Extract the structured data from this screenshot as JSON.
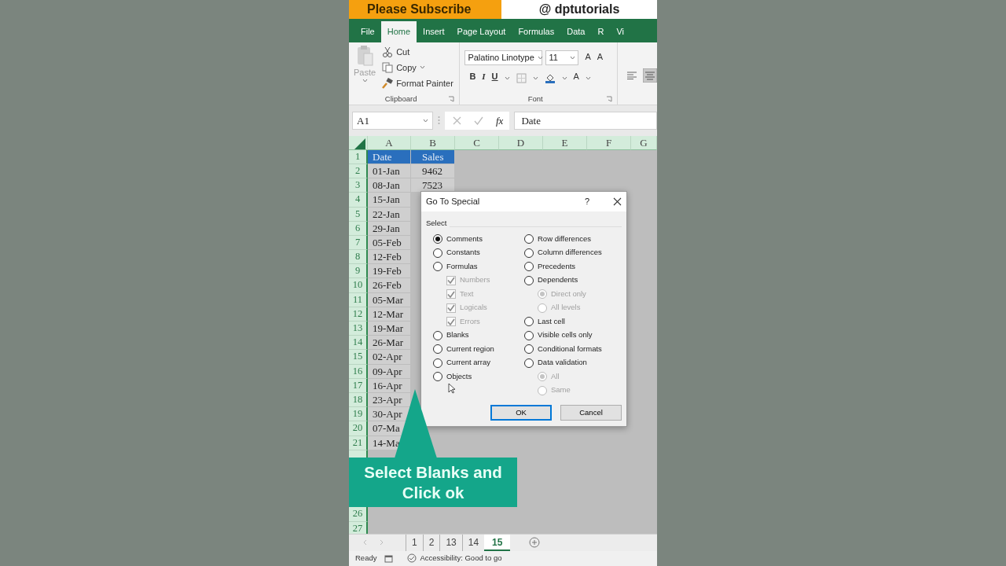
{
  "banner": {
    "left": "Please Subscribe",
    "right": "@ dptutorials"
  },
  "ribbon_tabs": [
    {
      "label": "File",
      "selected": false
    },
    {
      "label": "Home",
      "selected": true
    },
    {
      "label": "Insert",
      "selected": false
    },
    {
      "label": "Page Layout",
      "selected": false
    },
    {
      "label": "Formulas",
      "selected": false
    },
    {
      "label": "Data",
      "selected": false
    },
    {
      "label": "R",
      "selected": false
    },
    {
      "label": "Vi",
      "selected": false
    }
  ],
  "clipboard": {
    "paste": "Paste",
    "label": "Clipboard",
    "items": [
      {
        "kind": "cut",
        "label": "Cut"
      },
      {
        "kind": "copy",
        "label": "Copy"
      },
      {
        "kind": "painter",
        "label": "Format Painter"
      }
    ]
  },
  "font": {
    "name": "Palatino Linotype",
    "size": "11",
    "grow": "A",
    "shrink": "A",
    "bold": "B",
    "italic": "I",
    "underline": "U",
    "font_color_button": "A",
    "label": "Font"
  },
  "formula_bar": {
    "name_box": "A1",
    "fx": "fx",
    "formula": "Date"
  },
  "sheet": {
    "columns": [
      "A",
      "B",
      "C",
      "D",
      "E",
      "F",
      "G"
    ],
    "rows": [
      {
        "header": "1",
        "cells": [
          "Date",
          "Sales"
        ],
        "kind": "header"
      },
      {
        "header": "2",
        "cells": [
          "01-Jan",
          "9462"
        ]
      },
      {
        "header": "3",
        "cells": [
          "08-Jan",
          "7523"
        ]
      },
      {
        "header": "4",
        "cells": [
          "15-Jan"
        ]
      },
      {
        "header": "5",
        "cells": [
          "22-Jan"
        ]
      },
      {
        "header": "6",
        "cells": [
          "29-Jan"
        ]
      },
      {
        "header": "7",
        "cells": [
          "05-Feb"
        ]
      },
      {
        "header": "8",
        "cells": [
          "12-Feb"
        ]
      },
      {
        "header": "9",
        "cells": [
          "19-Feb"
        ]
      },
      {
        "header": "10",
        "cells": [
          "26-Feb"
        ]
      },
      {
        "header": "11",
        "cells": [
          "05-Mar"
        ]
      },
      {
        "header": "12",
        "cells": [
          "12-Mar"
        ]
      },
      {
        "header": "13",
        "cells": [
          "19-Mar"
        ]
      },
      {
        "header": "14",
        "cells": [
          "26-Mar"
        ]
      },
      {
        "header": "15",
        "cells": [
          "02-Apr"
        ]
      },
      {
        "header": "16",
        "cells": [
          "09-Apr"
        ]
      },
      {
        "header": "17",
        "cells": [
          "16-Apr"
        ]
      },
      {
        "header": "18",
        "cells": [
          "23-Apr"
        ]
      },
      {
        "header": "19",
        "cells": [
          "30-Apr"
        ]
      },
      {
        "header": "20",
        "cells": [
          "07-Ma"
        ]
      },
      {
        "header": "21",
        "cells": [
          "14-Ma"
        ]
      },
      {},
      {},
      {},
      {},
      {
        "header": "26"
      },
      {
        "header": "27"
      }
    ]
  },
  "dialog": {
    "title": "Go To Special",
    "help": "?",
    "section": "Select",
    "left_options": [
      {
        "kind": "radio",
        "label": "Comments",
        "selected": true
      },
      {
        "kind": "radio",
        "label": "Constants",
        "selected": false
      },
      {
        "kind": "radio",
        "label": "Formulas",
        "selected": false,
        "children": [
          {
            "kind": "checkbox",
            "label": "Numbers",
            "checked": true,
            "disabled": true
          },
          {
            "kind": "checkbox",
            "label": "Text",
            "checked": true,
            "disabled": true
          },
          {
            "kind": "checkbox",
            "label": "Logicals",
            "checked": true,
            "disabled": true
          },
          {
            "kind": "checkbox",
            "label": "Errors",
            "checked": true,
            "disabled": true
          }
        ]
      },
      {
        "kind": "radio",
        "label": "Blanks",
        "selected": false
      },
      {
        "kind": "radio",
        "label": "Current region",
        "selected": false
      },
      {
        "kind": "radio",
        "label": "Current array",
        "selected": false
      },
      {
        "kind": "radio",
        "label": "Objects",
        "selected": false
      }
    ],
    "right_options": [
      {
        "kind": "radio",
        "label": "Row differences",
        "selected": false
      },
      {
        "kind": "radio",
        "label": "Column differences",
        "selected": false
      },
      {
        "kind": "radio",
        "label": "Precedents",
        "selected": false
      },
      {
        "kind": "radio",
        "label": "Dependents",
        "selected": false,
        "children": [
          {
            "kind": "radio",
            "label": "Direct only",
            "selected": true,
            "disabled": true
          },
          {
            "kind": "radio",
            "label": "All levels",
            "selected": false,
            "disabled": true
          }
        ]
      },
      {
        "kind": "radio",
        "label": "Last cell",
        "selected": false
      },
      {
        "kind": "radio",
        "label": "Visible cells only",
        "selected": false
      },
      {
        "kind": "radio",
        "label": "Conditional formats",
        "selected": false
      },
      {
        "kind": "radio",
        "label": "Data validation",
        "selected": false,
        "children": [
          {
            "kind": "radio",
            "label": "All",
            "selected": true,
            "disabled": true
          },
          {
            "kind": "radio",
            "label": "Same",
            "selected": false,
            "disabled": true
          }
        ]
      }
    ],
    "buttons": [
      {
        "label": "OK",
        "focused": true
      },
      {
        "label": "Cancel",
        "focused": false
      }
    ]
  },
  "callout": "Select Blanks and Click ok",
  "sheet_tabs": [
    {
      "label": "1",
      "selected": false
    },
    {
      "label": "2",
      "selected": false
    },
    {
      "label": "13",
      "selected": false
    },
    {
      "label": "14",
      "selected": false
    },
    {
      "label": "15",
      "selected": true
    }
  ],
  "status_bar": {
    "ready": "Ready",
    "accessibility": "Accessibility: Good to go"
  }
}
